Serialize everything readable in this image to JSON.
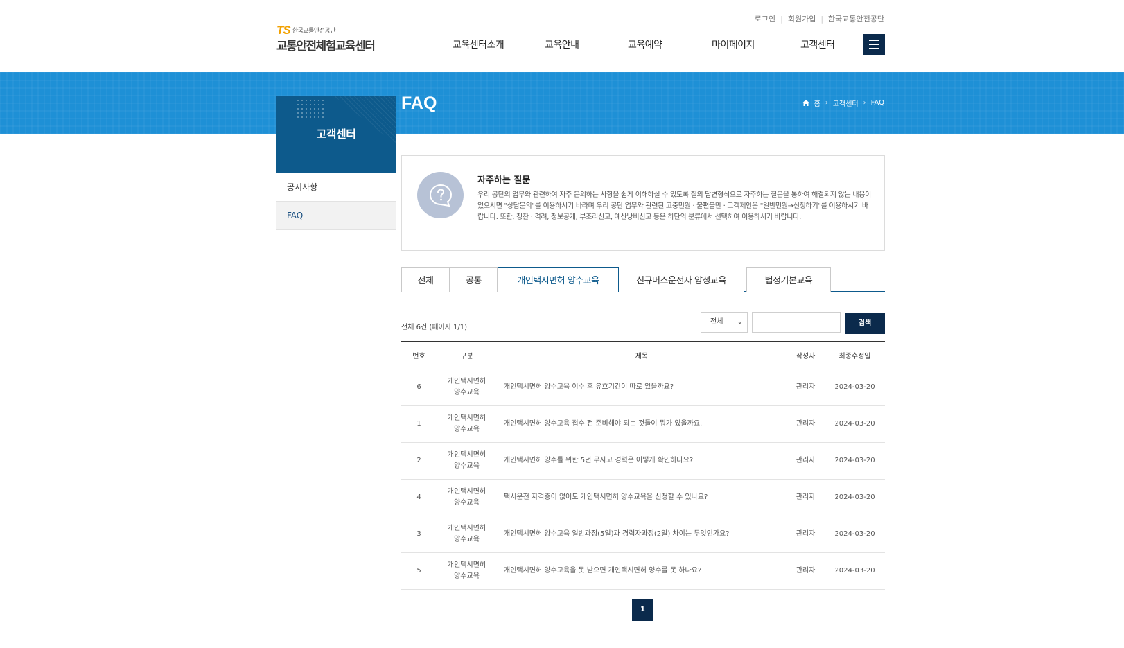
{
  "header": {
    "util_links": [
      "로그인",
      "회원가입",
      "한국교통안전공단"
    ],
    "logo_ts": "TS",
    "logo_org": "한국교통안전공단",
    "logo_title": "교통안전체험교육센터",
    "gnb": [
      "교육센터소개",
      "교육안내",
      "교육예약",
      "마이페이지",
      "고객센터"
    ]
  },
  "banner": {
    "title": "FAQ",
    "breadcrumb": [
      "홈",
      "고객센터",
      "FAQ"
    ]
  },
  "lnb": {
    "title": "고객센터",
    "items": [
      "공지사항",
      "FAQ"
    ]
  },
  "intro": {
    "title": "자주하는 질문",
    "desc": "우리 공단의 업무와 관련하여 자주 문의하는 사항을 쉽게 이해하실 수 있도록 질의 답변형식으로 자주하는 질문을 통하여 해결되지 않는 내용이 있으시면 \"상담문의\"를 이용하시기 바라며 우리 공단 업무와 관련된 고충민원 · 불편불만 · 고객제안은 \"일반민원→신청하기\"를 이용하시기 바랍니다. 또한, 칭찬 · 격려, 정보공개, 부조리신고, 예산낭비신고 등은 하단의 분류에서 선택하여 이용하시기 바랍니다."
  },
  "tabs": [
    "전체",
    "공통",
    "개인택시면허 양수교육",
    "신규버스운전자 양성교육",
    "법정기본교육"
  ],
  "list": {
    "count_text": "전체 6건 (페이지 1/1)",
    "select_value": "전체",
    "search_button": "검색",
    "headers": [
      "번호",
      "구분",
      "제목",
      "작성자",
      "최종수정일"
    ],
    "rows": [
      {
        "no": "6",
        "cat1": "개인택시면허",
        "cat2": "양수교육",
        "title": "개인택시면허 양수교육 이수 후 유효기간이 따로 있을까요?",
        "author": "관리자",
        "date": "2024-03-20"
      },
      {
        "no": "1",
        "cat1": "개인택시면허",
        "cat2": "양수교육",
        "title": "개인택시면허 양수교육 접수 전 준비해야 되는 것들이 뭐가 있을까요.",
        "author": "관리자",
        "date": "2024-03-20"
      },
      {
        "no": "2",
        "cat1": "개인택시면허",
        "cat2": "양수교육",
        "title": "개인택시면허 양수를 위한 5년 무사고 경력은 어떻게 확인하나요?",
        "author": "관리자",
        "date": "2024-03-20"
      },
      {
        "no": "4",
        "cat1": "개인택시면허",
        "cat2": "양수교육",
        "title": "택시운전 자격증이 없어도 개인택시면허 양수교육을 신청할 수 있나요?",
        "author": "관리자",
        "date": "2024-03-20"
      },
      {
        "no": "3",
        "cat1": "개인택시면허",
        "cat2": "양수교육",
        "title": "개인택시면허 양수교육 일반과정(5일)과 경력자과정(2일) 차이는 무엇인가요?",
        "author": "관리자",
        "date": "2024-03-20"
      },
      {
        "no": "5",
        "cat1": "개인택시면허",
        "cat2": "양수교육",
        "title": "개인택시면허 양수교육을 못 받으면 개인택시면허 양수를 못 하나요?",
        "author": "관리자",
        "date": "2024-03-20"
      }
    ]
  },
  "pagination": {
    "current": "1"
  },
  "colors": {
    "navy": "#0b2a4c",
    "banner": "#1e90d6",
    "lnb": "#0d5a8c"
  }
}
